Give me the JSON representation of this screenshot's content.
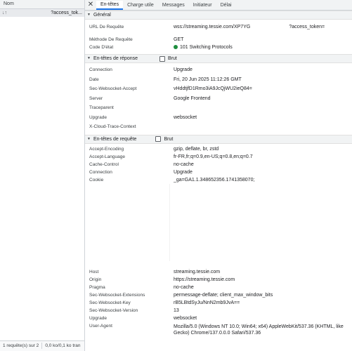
{
  "left_panel": {
    "header": "Nom",
    "request_name": "?access_tok...",
    "status_bar": [
      "1 requête(s) sur 2",
      "0,0 ko/0,1 ko tran"
    ]
  },
  "tabs": [
    "En-têtes",
    "Charge utile",
    "Messages",
    "Initiateur",
    "Délai"
  ],
  "general": {
    "title": "Général",
    "rows": [
      {
        "k": "URL De Requête",
        "v": "wss://streaming.tessie.com/XP7YG",
        "extra": "?access_token="
      },
      {
        "k": "Méthode De Requête",
        "v": "GET"
      },
      {
        "k": "Code D'état",
        "v": "101 Switching Protocols"
      }
    ]
  },
  "response": {
    "title": "En-têtes de réponse",
    "raw_label": "Brut",
    "rows": [
      {
        "k": "Connection",
        "v": "Upgrade"
      },
      {
        "k": "Date",
        "v": "Fri, 20 Jun 2025 11:12:26 GMT"
      },
      {
        "k": "Sec-Websocket-Accept",
        "v": "vHddtjfD1Rmo3iA9JcQjWU2ieQ84="
      },
      {
        "k": "Server",
        "v": "Google Frontend"
      },
      {
        "k": "Traceparent",
        "v": ""
      },
      {
        "k": "Upgrade",
        "v": "websocket"
      },
      {
        "k": "X-Cloud-Trace-Context",
        "v": ""
      }
    ]
  },
  "request": {
    "title": "En-têtes de requête",
    "raw_label": "Brut",
    "rows_top": [
      {
        "k": "Accept-Encoding",
        "v": "gzip, deflate, br, zstd"
      },
      {
        "k": "Accept-Language",
        "v": "fr-FR,fr;q=0.9,en-US;q=0.8,en;q=0.7"
      },
      {
        "k": "Cache-Control",
        "v": "no-cache"
      },
      {
        "k": "Connection",
        "v": "Upgrade"
      },
      {
        "k": "Cookie",
        "v": "_ga=GA1.1.348652356.1741358070;"
      }
    ],
    "rows_bottom": [
      {
        "k": "Host",
        "v": "streaming.tessie.com"
      },
      {
        "k": "Origin",
        "v": "https://streaming.tessie.com"
      },
      {
        "k": "Pragma",
        "v": "no-cache"
      },
      {
        "k": "Sec-Websocket-Extensions",
        "v": "permessage-deflate; client_max_window_bits"
      },
      {
        "k": "Sec-Websocket-Key",
        "v": "rB5LBtdSyJu/NnN2mb9JvA=="
      },
      {
        "k": "Sec-Websocket-Version",
        "v": "13"
      },
      {
        "k": "Upgrade",
        "v": "websocket"
      },
      {
        "k": "User-Agent",
        "v": "Mozilla/5.0 (Windows NT 10.0; Win64; x64) AppleWebKit/537.36 (KHTML, like Gecko) Chrome/137.0.0.0 Safari/537.36"
      }
    ]
  },
  "colors": {
    "accent": "#1a73e8",
    "status_ok": "#1e8e3e"
  }
}
